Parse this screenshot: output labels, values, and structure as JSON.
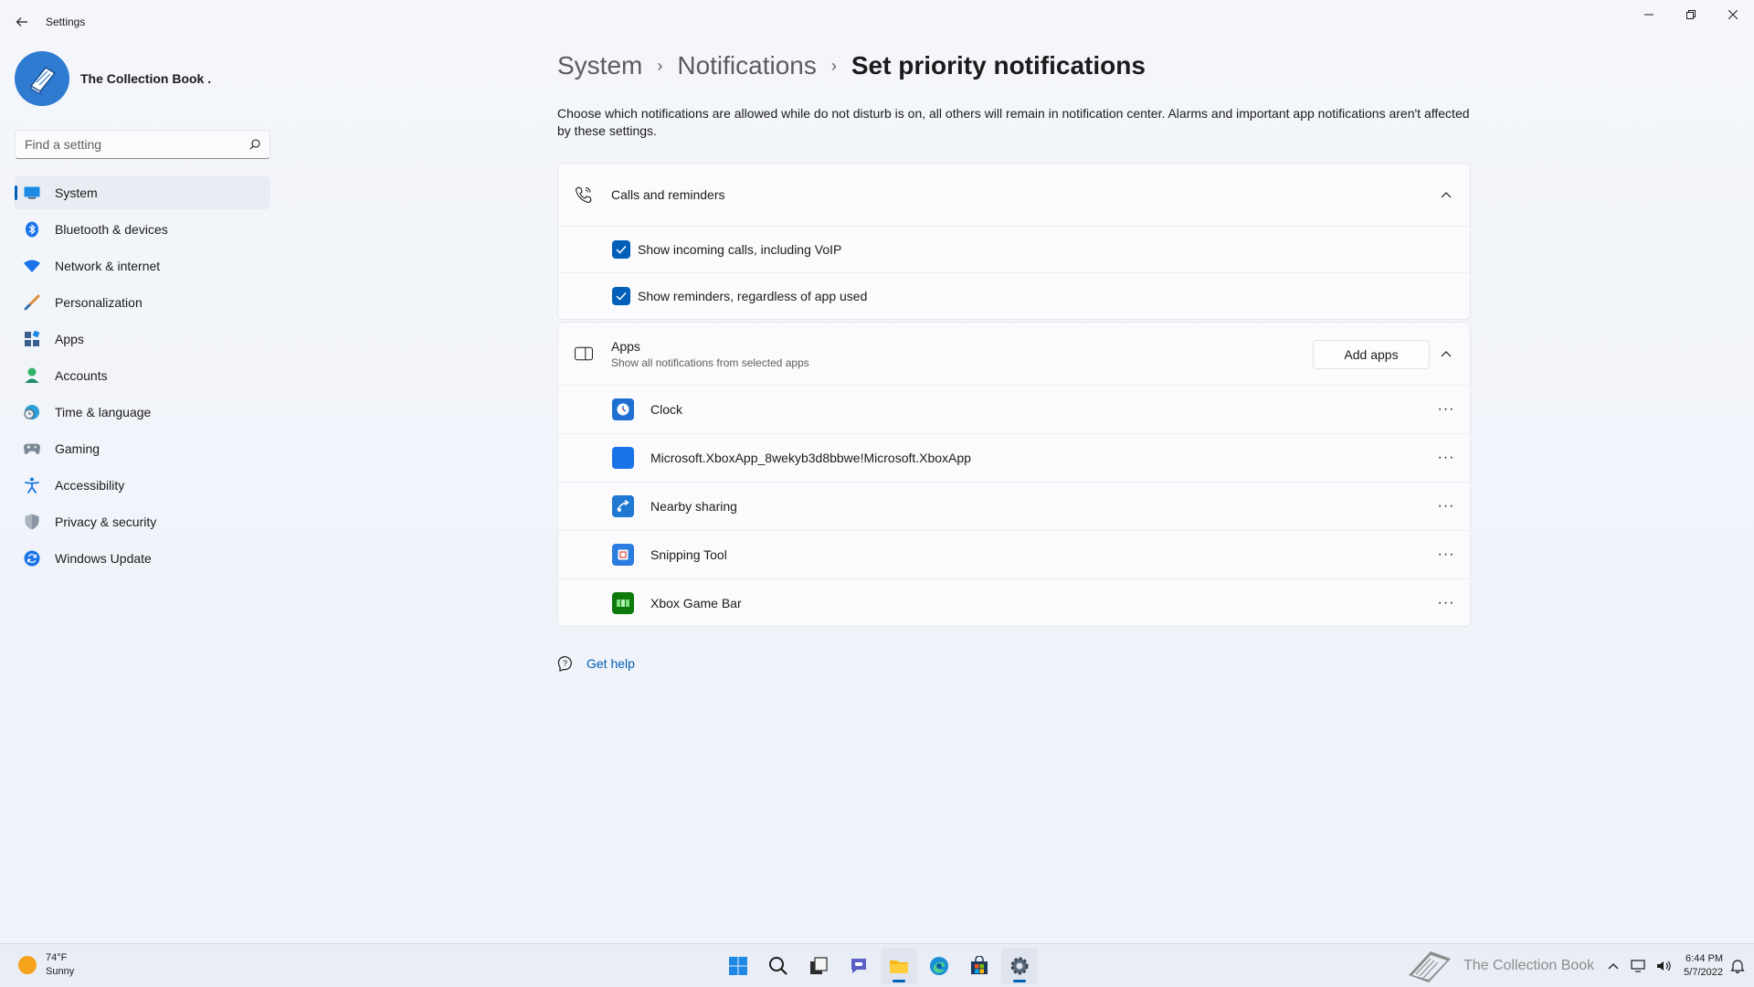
{
  "window": {
    "app_title": "Settings",
    "controls": [
      "minimize-icon",
      "restore-icon",
      "close-icon"
    ]
  },
  "profile": {
    "name": "The Collection Book ."
  },
  "search": {
    "placeholder": "Find a setting",
    "value": ""
  },
  "sidebar": {
    "items": [
      {
        "label": "System",
        "icon": "system-icon",
        "active": true
      },
      {
        "label": "Bluetooth & devices",
        "icon": "bluetooth-icon"
      },
      {
        "label": "Network & internet",
        "icon": "wifi-icon"
      },
      {
        "label": "Personalization",
        "icon": "brush-icon"
      },
      {
        "label": "Apps",
        "icon": "apps-icon"
      },
      {
        "label": "Accounts",
        "icon": "account-icon"
      },
      {
        "label": "Time & language",
        "icon": "globe-clock-icon"
      },
      {
        "label": "Gaming",
        "icon": "controller-icon"
      },
      {
        "label": "Accessibility",
        "icon": "accessibility-icon"
      },
      {
        "label": "Privacy & security",
        "icon": "shield-icon"
      },
      {
        "label": "Windows Update",
        "icon": "update-icon"
      }
    ]
  },
  "breadcrumb": {
    "items": [
      "System",
      "Notifications"
    ],
    "current": "Set priority notifications",
    "separator": "›"
  },
  "description": "Choose which notifications are allowed while do not disturb is on, all others will remain in notification center. Alarms and important app notifications aren't affected by these settings.",
  "calls_section": {
    "title": "Calls and reminders",
    "icon": "phone-icon",
    "expanded": true,
    "options": [
      {
        "label": "Show incoming calls, including VoIP",
        "checked": true
      },
      {
        "label": "Show reminders, regardless of app used",
        "checked": true
      }
    ]
  },
  "apps_section": {
    "title": "Apps",
    "subtitle": "Show all notifications from selected apps",
    "icon": "app-window-icon",
    "add_button": "Add apps",
    "expanded": true,
    "apps": [
      {
        "name": "Clock",
        "icon": "clock-app-icon",
        "color": "#1f6fd1"
      },
      {
        "name": "Microsoft.XboxApp_8wekyb3d8bbwe!Microsoft.XboxApp",
        "icon": "blank-app-icon",
        "color": "#1a73e8"
      },
      {
        "name": "Nearby sharing",
        "icon": "nearby-sharing-icon",
        "color": "#1f78d1"
      },
      {
        "name": "Snipping Tool",
        "icon": "snipping-tool-icon",
        "color": "#2b7de0"
      },
      {
        "name": "Xbox Game Bar",
        "icon": "xbox-game-bar-icon",
        "color": "#0e7a0d"
      }
    ],
    "more_label": "···"
  },
  "help": {
    "label": "Get help",
    "icon": "help-icon"
  },
  "taskbar": {
    "weather": {
      "temp": "74°F",
      "condition": "Sunny"
    },
    "pinned": [
      {
        "name": "start-icon",
        "active": false
      },
      {
        "name": "search-icon",
        "active": false
      },
      {
        "name": "task-view-icon",
        "active": false
      },
      {
        "name": "chat-icon",
        "active": false
      },
      {
        "name": "file-explorer-icon",
        "active": true,
        "running": true
      },
      {
        "name": "edge-icon",
        "active": false
      },
      {
        "name": "store-icon",
        "active": false
      },
      {
        "name": "settings-icon",
        "active": true,
        "running": true
      }
    ],
    "watermark": "The Collection Book",
    "time": "6:44 PM",
    "date": "5/7/2022"
  },
  "colors": {
    "accent": "#005fb8",
    "background": "#f3f5fa",
    "card": "#fbfbfd"
  }
}
